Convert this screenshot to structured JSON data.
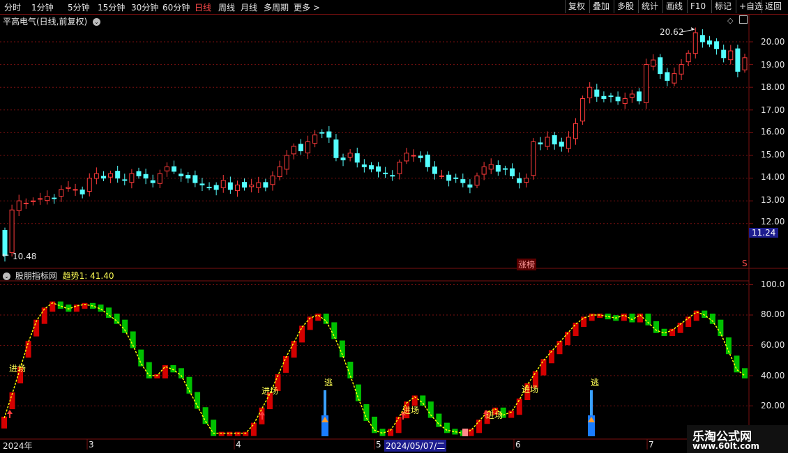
{
  "toolbar": {
    "periods": [
      "分时",
      "1分钟",
      "5分钟",
      "15分钟",
      "30分钟",
      "60分钟",
      "日线",
      "周线",
      "月线",
      "多周期",
      "更多 >"
    ],
    "active_period": "日线",
    "buttons": [
      "复权",
      "叠加",
      "多股",
      "统计",
      "画线",
      "F10",
      "标记",
      "+自选",
      "返回"
    ]
  },
  "main_panel": {
    "title": "平高电气(日线,前复权)",
    "high_label": "20.62",
    "low_label": "10.48",
    "current_price": "11.24",
    "y_ticks": [
      "20.00",
      "19.00",
      "18.00",
      "17.00",
      "16.00",
      "15.00",
      "14.00",
      "13.00",
      "12.00"
    ],
    "marker_label": "涨榜",
    "marker_s": "S"
  },
  "indicator_panel": {
    "title": "股朋指标网",
    "value_label": "趋势1: 41.40",
    "y_ticks": [
      "100.0",
      "80.00",
      "60.00",
      "40.00",
      "20.00"
    ],
    "entry_label": "进场",
    "escape_label": "逃"
  },
  "x_axis": {
    "labels": [
      "2024年",
      "3",
      "4",
      "5",
      "2024/05/07/二",
      "6",
      "7"
    ]
  },
  "watermark": {
    "line1": "乐淘公式网",
    "line2": "www.60lt.com"
  },
  "colors": {
    "up": "#ff3b3b",
    "down": "#54ffff",
    "trend_up": "#d40000",
    "trend_down": "#00c000",
    "trend_line": "#ffff00",
    "grid": "#7a1010"
  },
  "chart_data": {
    "type": "candlestick",
    "y_range": [
      10.48,
      20.62
    ],
    "indicator_range": [
      0,
      100
    ]
  }
}
